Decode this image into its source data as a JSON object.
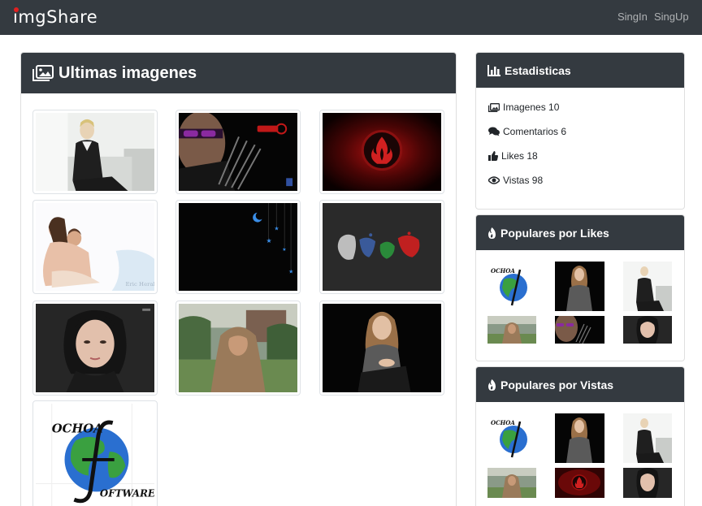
{
  "navbar": {
    "brand": "imgShare",
    "links": [
      "SingIn",
      "SingUp"
    ]
  },
  "main": {
    "title": "Ultimas imagenes",
    "images": [
      {
        "icon": "woman-sitting-photo"
      },
      {
        "icon": "archer-photo"
      },
      {
        "icon": "fire-emblem-photo"
      },
      {
        "icon": "couple-embrace-photo"
      },
      {
        "icon": "night-stars-photo"
      },
      {
        "icon": "ink-splash-photo"
      },
      {
        "icon": "portrait-dark-hair-photo"
      },
      {
        "icon": "woman-hijab-photo"
      },
      {
        "icon": "woman-seated-photo"
      },
      {
        "icon": "ochoa-software-logo"
      }
    ],
    "logo_text_top": "OCHOA",
    "logo_text_bottom": "OFTWARE"
  },
  "stats": {
    "title": "Estadisticas",
    "items": [
      {
        "label": "Imagenes 10",
        "icon": "images-icon"
      },
      {
        "label": "Comentarios 6",
        "icon": "comments-icon"
      },
      {
        "label": "Likes 18",
        "icon": "thumbs-up-icon"
      },
      {
        "label": "Vistas 98",
        "icon": "eye-icon"
      }
    ]
  },
  "popular_likes": {
    "title": "Populares por Likes",
    "icon": "fire-icon",
    "images": [
      "ochoa-software-logo",
      "woman-seated-photo",
      "woman-sitting-photo",
      "woman-hijab-photo",
      "archer-photo",
      "portrait-dark-hair-photo"
    ]
  },
  "popular_views": {
    "title": "Populares por Vistas",
    "icon": "fire-icon",
    "images": [
      "ochoa-software-logo",
      "woman-seated-photo",
      "woman-sitting-photo",
      "woman-hijab-photo",
      "fire-emblem-photo",
      "portrait-dark-hair-photo"
    ]
  },
  "colors": {
    "navbar": "#343a40",
    "card_header": "#343a40",
    "brand_dot": "#e02020"
  }
}
